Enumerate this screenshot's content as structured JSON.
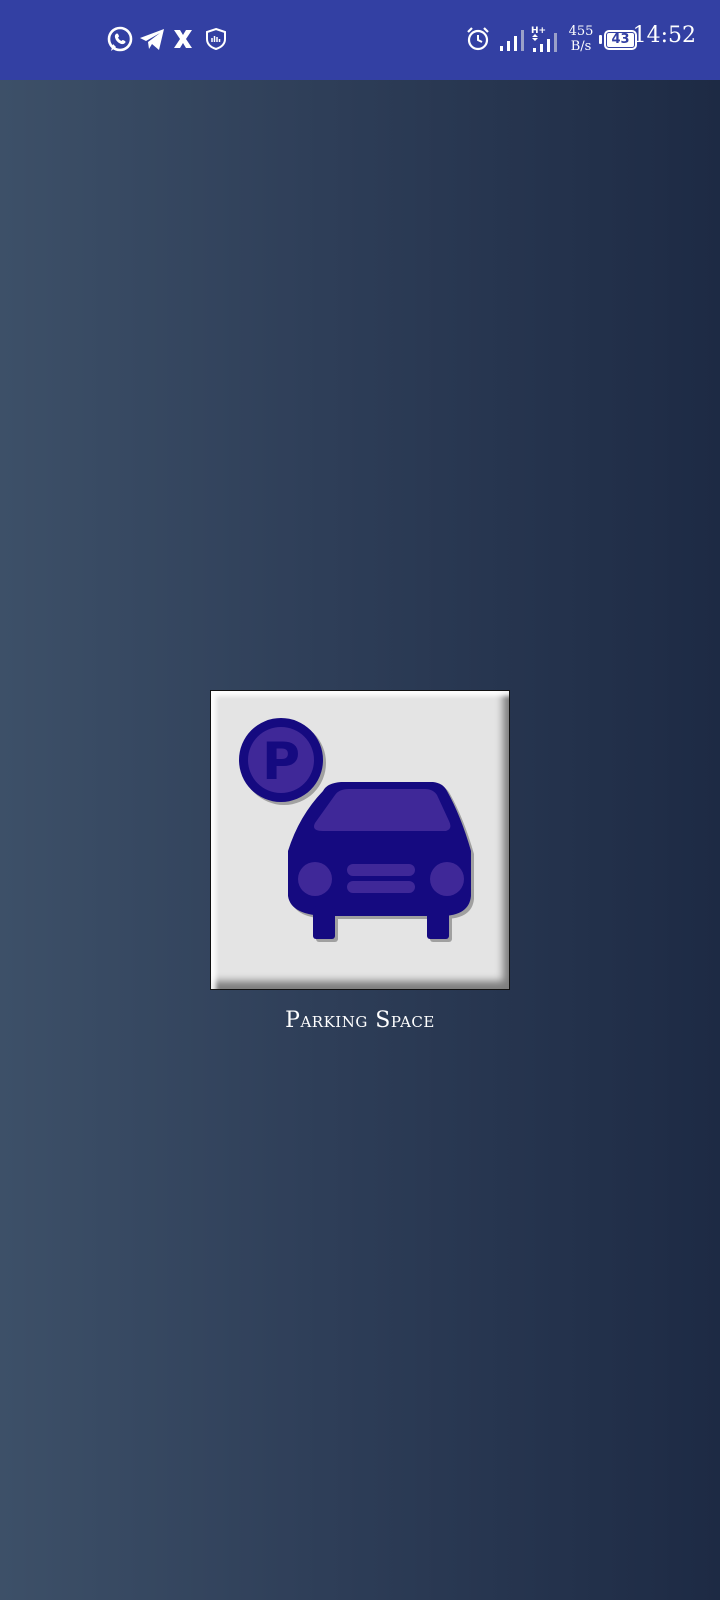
{
  "status_bar": {
    "time": "14:52",
    "net_speed_value": "455",
    "net_speed_unit": "B/s",
    "battery_level": "43",
    "notification_icons": [
      "whatsapp-icon",
      "telegram-icon",
      "x-icon",
      "vpn-shield-icon"
    ],
    "system_icons": [
      "alarm-icon",
      "signal-bars-icon",
      "signal-hplus-icon",
      "battery-icon"
    ]
  },
  "main": {
    "tile_label": "Parking Space",
    "tile_icon": "parking-car-icon",
    "parking_sign_letter": "P"
  },
  "colors": {
    "status_bar": "#3340a3",
    "icon_dark": "#150a80",
    "icon_light": "#3f2898",
    "tile_bg": "#e4e4e4"
  }
}
